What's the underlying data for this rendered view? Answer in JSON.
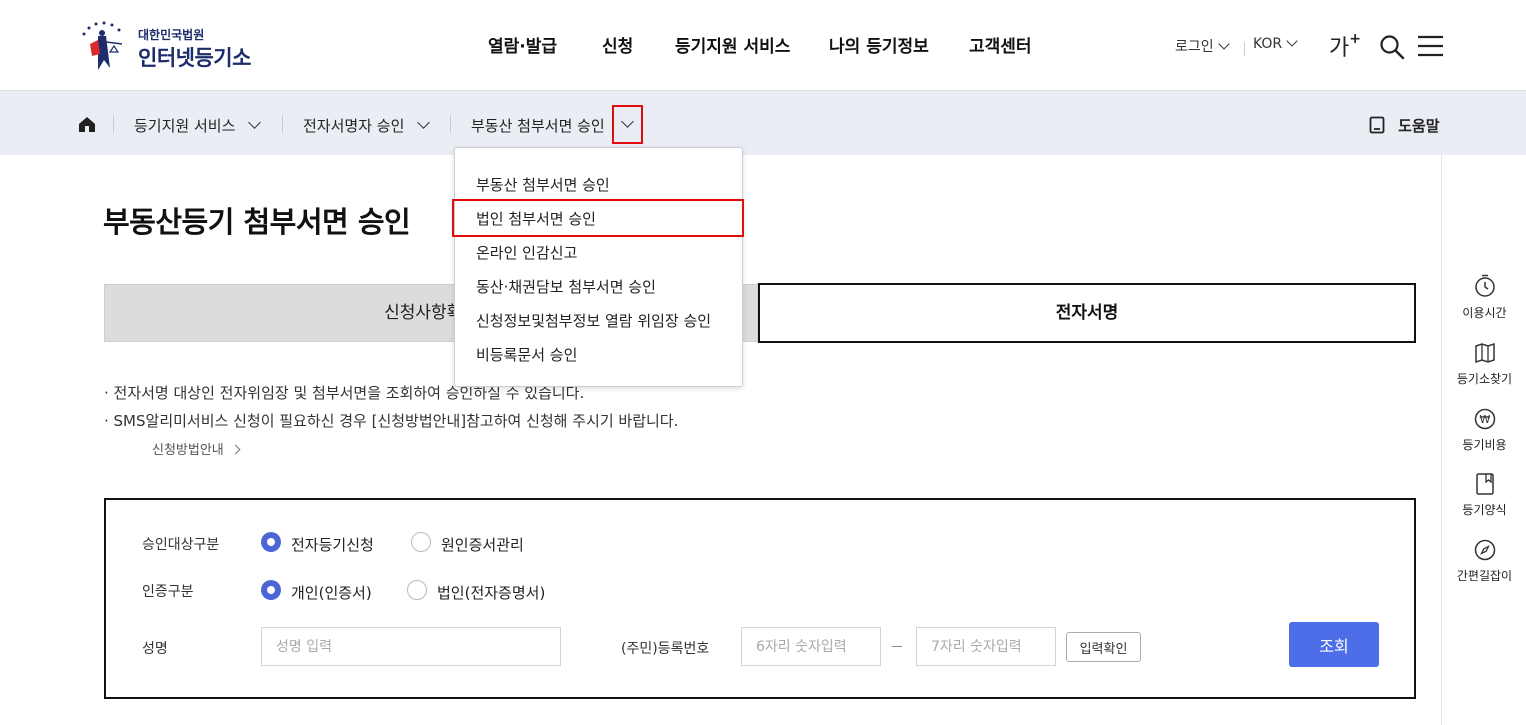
{
  "header": {
    "logo_small": "대한민국법원",
    "logo_big": "인터넷등기소",
    "nav": [
      "열람·발급",
      "신청",
      "등기지원 서비스",
      "나의 등기정보",
      "고객센터"
    ],
    "login_label": "로그인",
    "lang_label": "KOR",
    "font_size_label": "가",
    "font_size_plus": "+"
  },
  "breadcrumb": {
    "items": [
      "등기지원 서비스",
      "전자서명자 승인",
      "부동산 첨부서면 승인"
    ],
    "help_label": "도움말"
  },
  "dropdown": {
    "items": [
      "부동산 첨부서면 승인",
      "법인 첨부서면 승인",
      "온라인 인감신고",
      "동산·채권담보 첨부서면 승인",
      "신청정보및첨부정보 열람 위임장 승인",
      "비등록문서 승인"
    ]
  },
  "page": {
    "title": "부동산등기 첨부서면 승인",
    "tabs": [
      "신청사항확인",
      "전자서명"
    ],
    "notes": [
      "· 전자서명 대상인 전자위임장 및 첨부서면을 조회하여 승인하실 수 있습니다.",
      "· SMS알리미서비스 신청이 필요하신 경우 [신청방법안내]참고하여 신청해 주시기 바랍니다."
    ],
    "guide_link": "신청방법안내"
  },
  "form": {
    "target_label": "승인대상구분",
    "target_options": [
      "전자등기신청",
      "원인증서관리"
    ],
    "auth_label": "인증구분",
    "auth_options": [
      "개인(인증서)",
      "법인(전자증명서)"
    ],
    "name_label": "성명",
    "name_placeholder": "성명 입력",
    "reg_label": "(주민)등록번호",
    "reg1_placeholder": "6자리 숫자입력",
    "reg2_placeholder": "7자리 숫자입력",
    "confirm_label": "입력확인",
    "search_label": "조회"
  },
  "quick_menu": [
    "이용시간",
    "등기소찾기",
    "등기비용",
    "등기양식",
    "간편길잡이"
  ],
  "colors": {
    "accent": "#4d6ee8",
    "highlight": "#e10d0d",
    "breadcrumb_bg": "#eaedf3"
  }
}
